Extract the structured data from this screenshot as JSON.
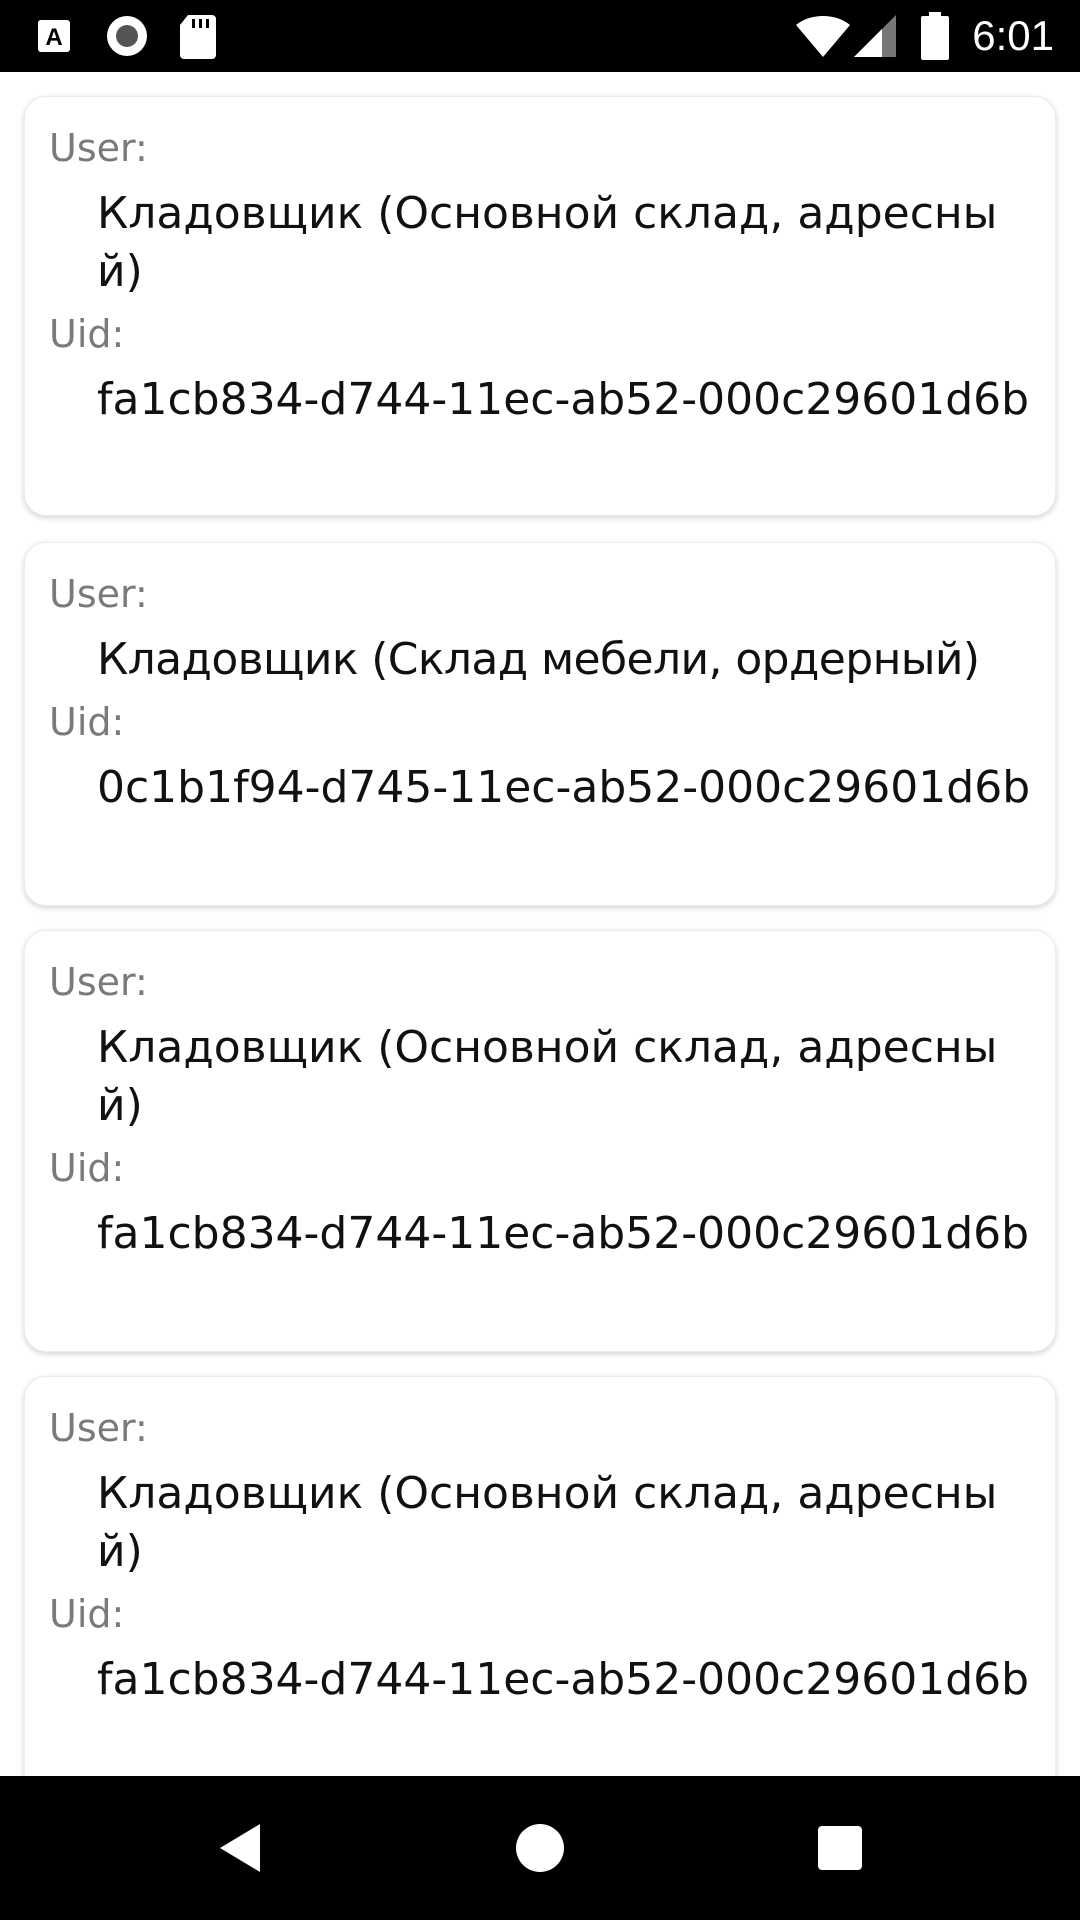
{
  "status_bar": {
    "time": "6:01",
    "icons": [
      "a-keyboard-icon",
      "record-icon",
      "sd-card-icon",
      "wifi-icon",
      "signal-icon",
      "battery-icon"
    ]
  },
  "cards": [
    {
      "user_label": "User:",
      "user_value": "Кладовщик (Основной склад, адресный)",
      "uid_label": "Uid:",
      "uid_value": "fa1cb834-d744-11ec-ab52-000c29601d6b"
    },
    {
      "user_label": "User:",
      "user_value": "Кладовщик (Склад мебели, ордерный)",
      "uid_label": "Uid:",
      "uid_value": "0c1b1f94-d745-11ec-ab52-000c29601d6b"
    },
    {
      "user_label": "User:",
      "user_value": "Кладовщик (Основной склад, адресный)",
      "uid_label": "Uid:",
      "uid_value": "fa1cb834-d744-11ec-ab52-000c29601d6b"
    },
    {
      "user_label": "User:",
      "user_value": "Кладовщик (Основной склад, адресный)",
      "uid_label": "Uid:",
      "uid_value": "fa1cb834-d744-11ec-ab52-000c29601d6b"
    }
  ],
  "nav_bar": {
    "buttons": [
      "back-icon",
      "home-icon",
      "recents-icon"
    ]
  }
}
